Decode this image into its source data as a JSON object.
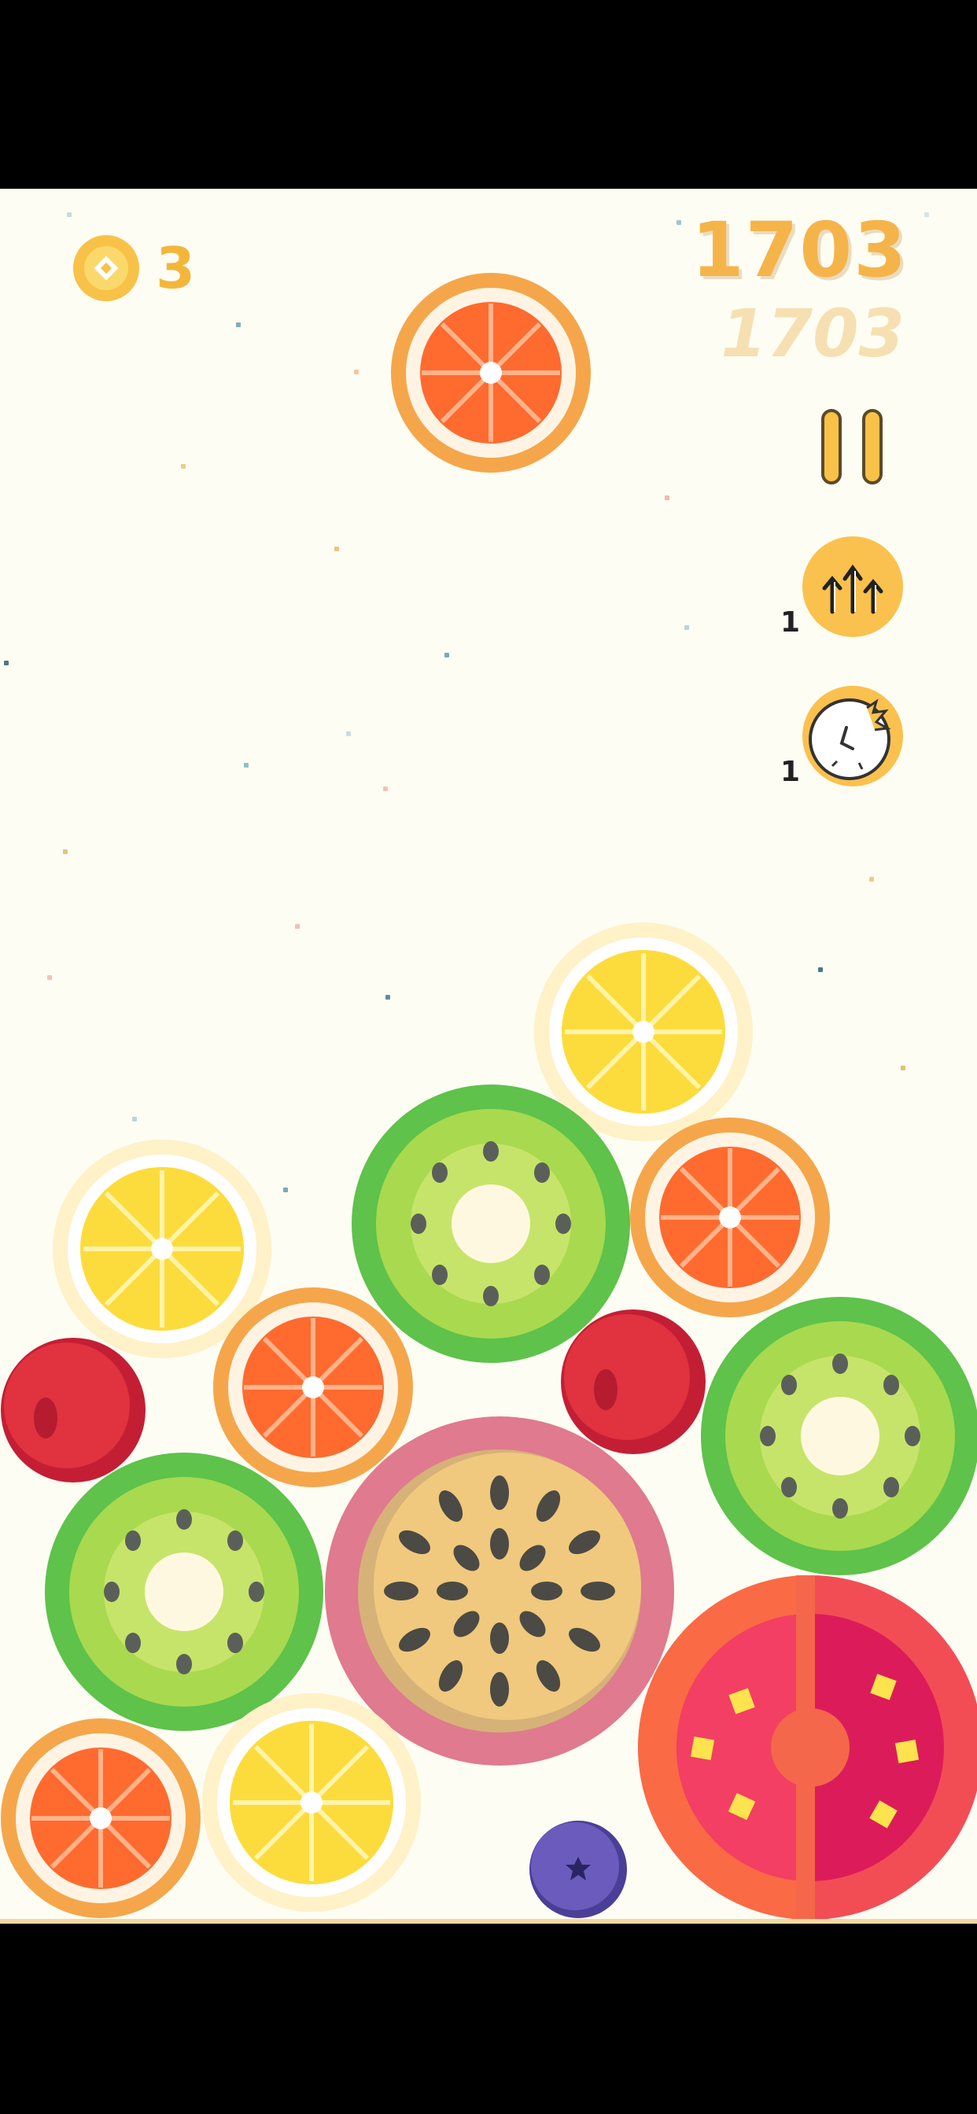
{
  "hud": {
    "coins": "3",
    "score": "1703",
    "best_score": "1703",
    "pause_label": "Pause",
    "powerups": [
      {
        "name": "shake",
        "count": "1",
        "icon": "arrows-up-icon"
      },
      {
        "name": "smash",
        "count": "1",
        "icon": "smash-clock-icon"
      }
    ]
  },
  "colors": {
    "background": "#fefdf3",
    "accent": "#f5b449",
    "coin": "#f7c247"
  },
  "fruits": {
    "next": "orange",
    "on_board": [
      "orange",
      "lemon",
      "kiwi",
      "orange",
      "lemon",
      "orange",
      "cherry",
      "cherry",
      "kiwi",
      "kiwi",
      "passionfruit",
      "orange",
      "lemon",
      "blueberry",
      "tomato"
    ]
  }
}
